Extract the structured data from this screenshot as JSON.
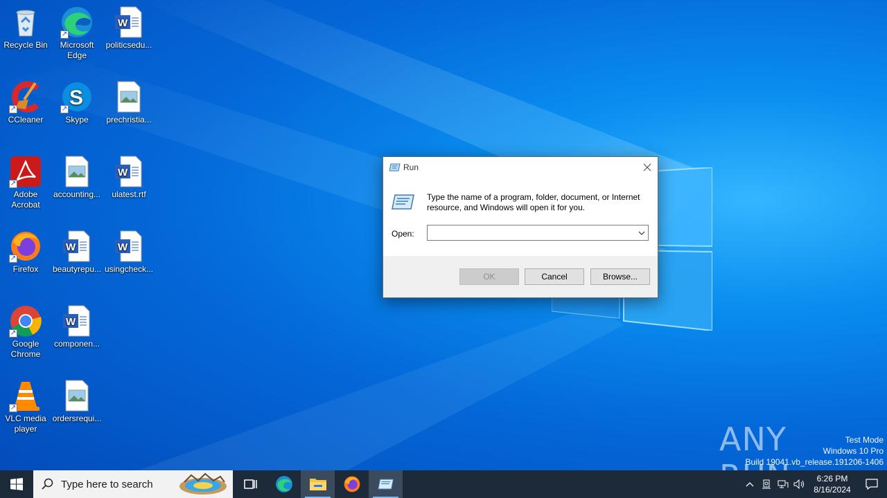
{
  "desktop": {
    "icons": [
      {
        "id": "recycle-bin",
        "label": "Recycle Bin"
      },
      {
        "id": "edge",
        "label": "Microsoft Edge"
      },
      {
        "id": "politicsedu",
        "label": "politicsedu..."
      },
      {
        "id": "ccleaner",
        "label": "CCleaner"
      },
      {
        "id": "skype",
        "label": "Skype"
      },
      {
        "id": "prechristia",
        "label": "prechristia..."
      },
      {
        "id": "acrobat",
        "label": "Adobe Acrobat"
      },
      {
        "id": "accounting",
        "label": "accounting..."
      },
      {
        "id": "ulatest",
        "label": "ulatest.rtf"
      },
      {
        "id": "firefox",
        "label": "Firefox"
      },
      {
        "id": "beautyrepu",
        "label": "beautyrepu..."
      },
      {
        "id": "usingcheck",
        "label": "usingcheck..."
      },
      {
        "id": "chrome",
        "label": "Google Chrome"
      },
      {
        "id": "componen",
        "label": "componen..."
      },
      {
        "id": "vlc",
        "label": "VLC media player"
      },
      {
        "id": "ordersrequi",
        "label": "ordersrequi..."
      }
    ]
  },
  "run_dialog": {
    "title": "Run",
    "description": "Type the name of a program, folder, document, or Internet resource, and Windows will open it for you.",
    "open_label": "Open:",
    "open_value": "",
    "ok_label": "OK",
    "cancel_label": "Cancel",
    "browse_label": "Browse..."
  },
  "watermark": {
    "brand": "ANY RUN",
    "line1": "Test Mode",
    "line2": "Windows 10 Pro",
    "line3": "Build 19041.vb_release.191206-1406"
  },
  "taskbar": {
    "search_placeholder": "Type here to search",
    "time": "6:26 PM",
    "date": "8/16/2024"
  },
  "colors": {
    "taskbar_bg": "#1c2a3a",
    "desktop_blue": "#0468d8",
    "dialog_footer": "#f0f0f0"
  }
}
